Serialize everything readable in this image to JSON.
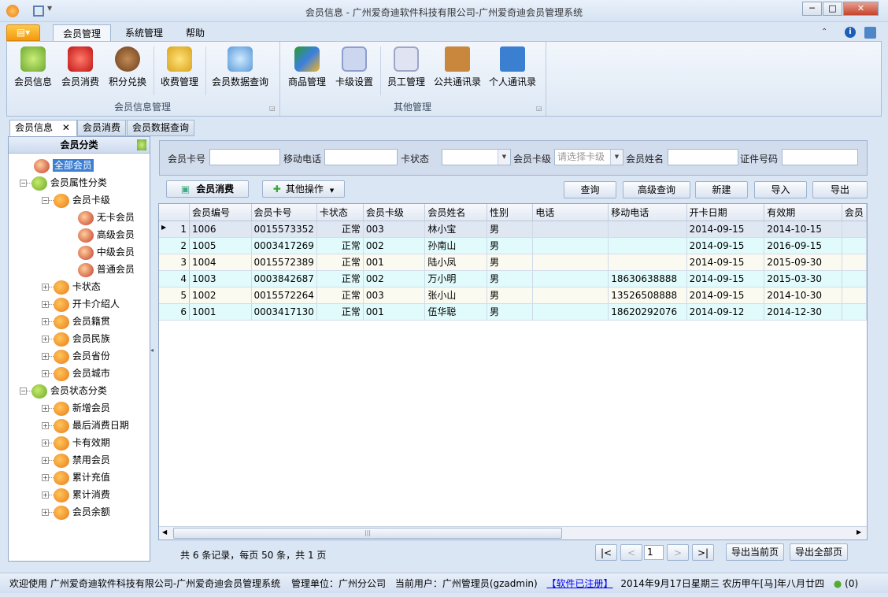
{
  "window": {
    "title": "会员信息 - 广州爱奇迪软件科技有限公司-广州爱奇迪会员管理系统"
  },
  "ribbon_tabs": [
    "会员管理",
    "系统管理",
    "帮助"
  ],
  "ribbon": {
    "groups": [
      {
        "label": "会员信息管理",
        "buttons": [
          "会员信息",
          "会员消费",
          "积分兑换",
          "收费管理",
          "会员数据查询"
        ]
      },
      {
        "label": "其他管理",
        "buttons": [
          "商品管理",
          "卡级设置",
          "员工管理",
          "公共通讯录",
          "个人通讯录"
        ]
      }
    ]
  },
  "doc_tabs": [
    "会员信息",
    "会员消费",
    "会员数据查询"
  ],
  "tree": {
    "title": "会员分类",
    "root": "全部会员",
    "nodes": [
      {
        "label": "会员属性分类",
        "level": 1
      },
      {
        "label": "会员卡级",
        "level": 2
      },
      {
        "label": "无卡会员",
        "level": 3
      },
      {
        "label": "高级会员",
        "level": 3
      },
      {
        "label": "中级会员",
        "level": 3
      },
      {
        "label": "普通会员",
        "level": 3
      },
      {
        "label": "卡状态",
        "level": 2
      },
      {
        "label": "开卡介绍人",
        "level": 2
      },
      {
        "label": "会员籍贯",
        "level": 2
      },
      {
        "label": "会员民族",
        "level": 2
      },
      {
        "label": "会员省份",
        "level": 2
      },
      {
        "label": "会员城市",
        "level": 2
      },
      {
        "label": "会员状态分类",
        "level": 1
      },
      {
        "label": "新增会员",
        "level": 2
      },
      {
        "label": "最后消费日期",
        "level": 2
      },
      {
        "label": "卡有效期",
        "level": 2
      },
      {
        "label": "禁用会员",
        "level": 2
      },
      {
        "label": "累计充值",
        "level": 2
      },
      {
        "label": "累计消费",
        "level": 2
      },
      {
        "label": "会员余额",
        "level": 2
      }
    ]
  },
  "search": {
    "card_no_label": "会员卡号",
    "card_no": "",
    "mobile_label": "移动电话",
    "mobile": "",
    "status_label": "卡状态",
    "status": "",
    "level_label": "会员卡级",
    "level_placeholder": "请选择卡级",
    "name_label": "会员姓名",
    "name": "",
    "id_label": "证件号码",
    "id": ""
  },
  "toolbar": {
    "consume": "会员消费",
    "other": "其他操作",
    "query": "查询",
    "advanced": "高级查询",
    "new": "新建",
    "import": "导入",
    "export": "导出"
  },
  "grid": {
    "columns": [
      "会员编号",
      "会员卡号",
      "卡状态",
      "会员卡级",
      "会员姓名",
      "性别",
      "电话",
      "移动电话",
      "开卡日期",
      "有效期",
      "会员"
    ],
    "rows": [
      [
        "1",
        "1006",
        "0015573352",
        "正常",
        "003",
        "林小宝",
        "男",
        "",
        "",
        "2014-09-15",
        "2014-10-15"
      ],
      [
        "2",
        "1005",
        "0003417269",
        "正常",
        "002",
        "孙南山",
        "男",
        "",
        "",
        "2014-09-15",
        "2016-09-15"
      ],
      [
        "3",
        "1004",
        "0015572389",
        "正常",
        "001",
        "陆小凤",
        "男",
        "",
        "",
        "2014-09-15",
        "2015-09-30"
      ],
      [
        "4",
        "1003",
        "0003842687",
        "正常",
        "002",
        "万小明",
        "男",
        "",
        "18630638888",
        "2014-09-15",
        "2015-03-30"
      ],
      [
        "5",
        "1002",
        "0015572264",
        "正常",
        "003",
        "张小山",
        "男",
        "",
        "13526508888",
        "2014-09-15",
        "2014-10-30"
      ],
      [
        "6",
        "1001",
        "0003417130",
        "正常",
        "001",
        "伍华聪",
        "男",
        "",
        "18620292076",
        "2014-09-12",
        "2014-12-30"
      ]
    ]
  },
  "pager": {
    "summary": "共 6 条记录，每页 50 条，共 1 页",
    "first": "|<",
    "prev": "<",
    "page": "1",
    "next": ">",
    "last": ">|",
    "export_page": "导出当前页",
    "export_all": "导出全部页"
  },
  "status": {
    "welcome": "欢迎使用 广州爱奇迪软件科技有限公司-广州爱奇迪会员管理系统",
    "unit": "管理单位：广州分公司",
    "user": "当前用户：广州管理员(gzadmin)",
    "registered": "【软件已注册】",
    "date": "2014年9月17日星期三 农历甲午[马]年八月廿四",
    "online": "(0)"
  },
  "colors": {
    "accent": "#3c7fd3",
    "app_menu": "#f39a0c",
    "link": "#0000ee"
  }
}
